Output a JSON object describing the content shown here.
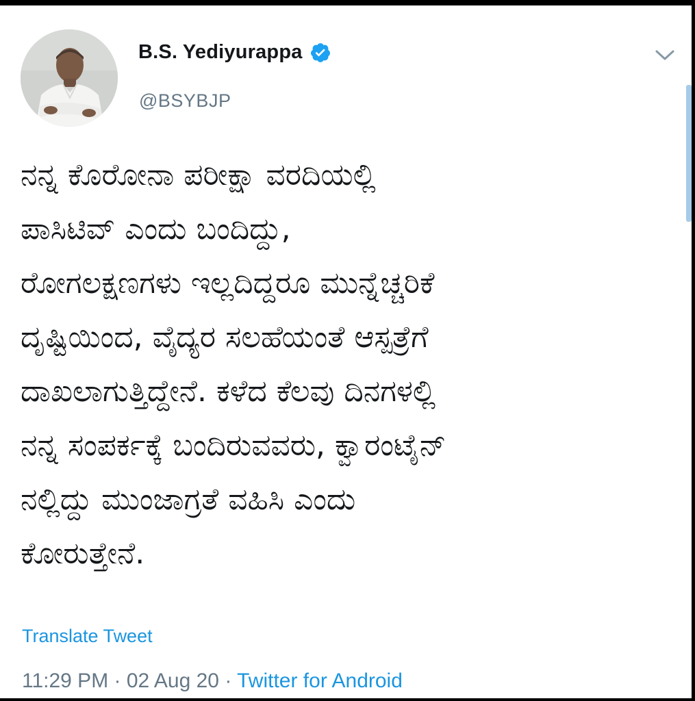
{
  "header": {
    "display_name": "B.S. Yediyurappa",
    "handle": "@BSYBJP"
  },
  "tweet": {
    "text": "ನನ್ನ ಕೊರೋನಾ ಪರೀಕ್ಷಾ ವರದಿಯಲ್ಲಿ\nಪಾಸಿಟಿವ್ ಎಂದು ಬಂದಿದ್ದು,\nರೋಗಲಕ್ಷಣಗಳು ಇಲ್ಲದಿದ್ದರೂ ಮುನ್ನೆಚ್ಚರಿಕೆ\nದೃಷ್ಟಿಯಿಂದ, ವೈದ್ಯರ ಸಲಹೆಯಂತೆ ಆಸ್ಪತ್ರೆಗೆ\nದಾಖಲಾಗುತ್ತಿದ್ದೇನೆ. ಕಳೆದ ಕೆಲವು ದಿನಗಳಲ್ಲಿ\nನನ್ನ ಸಂಪರ್ಕಕ್ಕೆ ಬಂದಿರುವವರು, ಕ್ವಾರಂಟೈನ್\nನಲ್ಲಿದ್ದು ಮುಂಜಾಗ್ರತೆ ವಹಿಸಿ ಎಂದು\nಕೋರುತ್ತೇನೆ.",
    "translate_label": "Translate Tweet"
  },
  "meta": {
    "time": "11:29 PM",
    "separator": " · ",
    "date": "02 Aug 20",
    "source": "Twitter for Android"
  },
  "icons": {
    "verified": "verified-badge-icon",
    "more": "chevron-down-icon"
  },
  "colors": {
    "accent": "#1b95e0",
    "text": "#14171a",
    "muted": "#657786"
  }
}
